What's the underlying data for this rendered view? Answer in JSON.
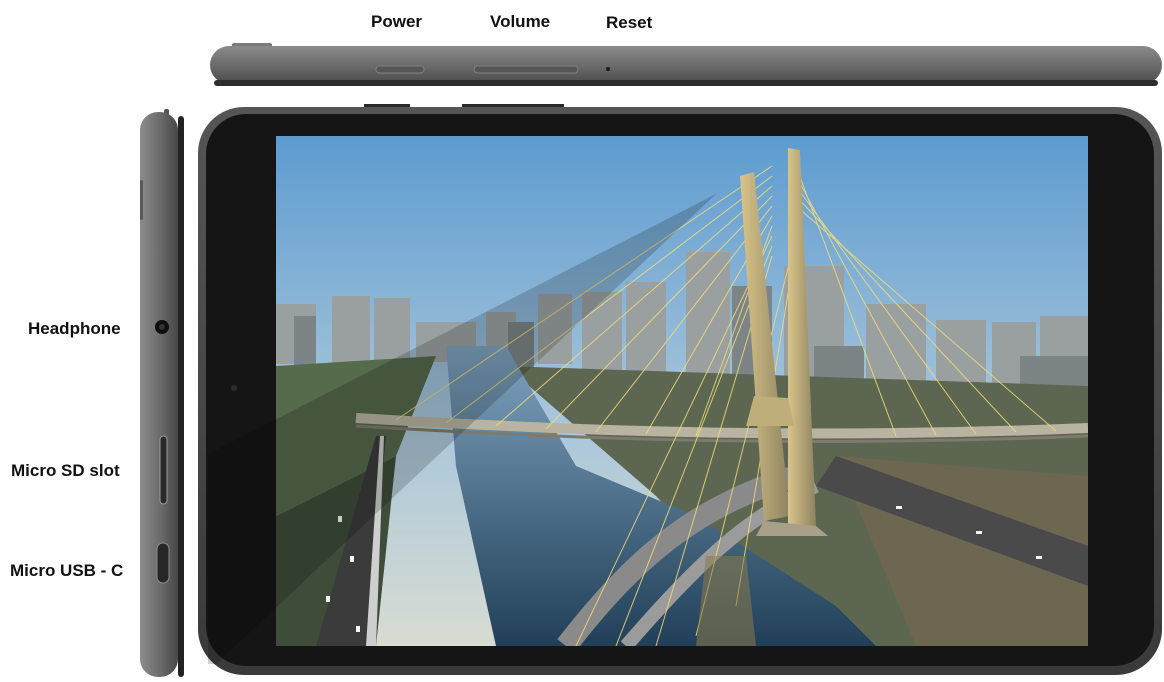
{
  "labels": {
    "power": "Power",
    "volume": "Volume",
    "reset": "Reset",
    "headphone": "Headphone",
    "micro_sd": "Micro SD slot",
    "micro_usb": "Micro USB - C"
  },
  "colors": {
    "body_gray": "#6e6e6e",
    "body_dark": "#3a3a3a",
    "bezel": "#161616",
    "sky_top": "#5d9bd0",
    "sky_bottom": "#cfd9d8",
    "water": "#2d5270",
    "bridge": "#c9b878",
    "cable": "#f2dc7a"
  },
  "screen": {
    "content": "cable-stayed-bridge-city-photo"
  }
}
